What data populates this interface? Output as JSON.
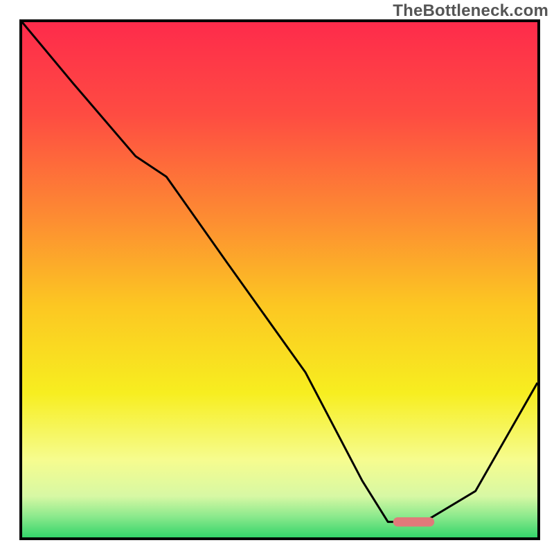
{
  "watermark": "TheBottleneck.com",
  "chart_data": {
    "type": "line",
    "title": "",
    "xlabel": "",
    "ylabel": "",
    "xlim": [
      0,
      100
    ],
    "ylim": [
      0,
      100
    ],
    "grid": false,
    "legend": false,
    "series": [
      {
        "name": "curve",
        "x": [
          0,
          10,
          22,
          28,
          40,
          55,
          66,
          71,
          78,
          88,
          100
        ],
        "y": [
          100,
          88,
          74,
          70,
          53,
          32,
          11,
          3,
          3,
          9,
          30
        ]
      }
    ],
    "marker": {
      "name": "highlight-segment",
      "x_start": 72,
      "x_end": 80,
      "y": 3,
      "color": "#e07a7a"
    },
    "background_gradient": {
      "direction": "vertical",
      "stops": [
        {
          "pos": 0.0,
          "color": "#fe2b4b"
        },
        {
          "pos": 0.18,
          "color": "#fe4c42"
        },
        {
          "pos": 0.38,
          "color": "#fd8c32"
        },
        {
          "pos": 0.55,
          "color": "#fcc722"
        },
        {
          "pos": 0.72,
          "color": "#f7ee20"
        },
        {
          "pos": 0.85,
          "color": "#f6fc8f"
        },
        {
          "pos": 0.92,
          "color": "#d7f8a4"
        },
        {
          "pos": 0.96,
          "color": "#8ae98c"
        },
        {
          "pos": 1.0,
          "color": "#34d46a"
        }
      ]
    }
  }
}
